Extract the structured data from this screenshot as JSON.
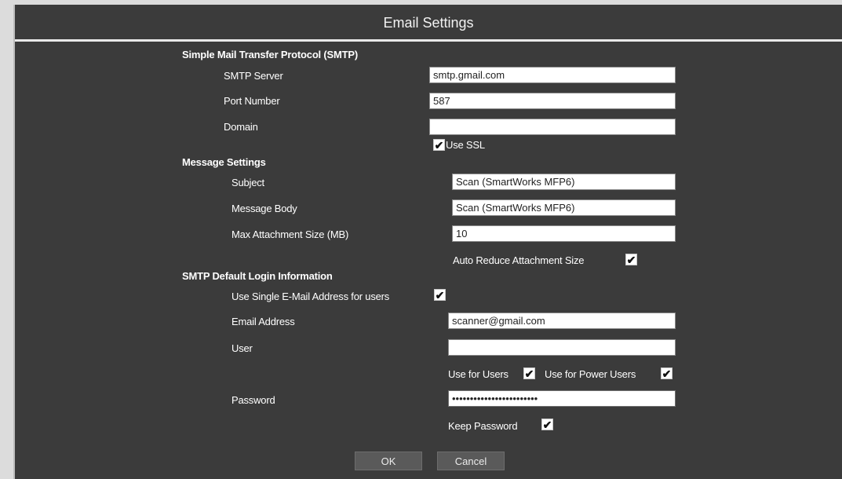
{
  "dialog": {
    "title": "Email Settings"
  },
  "smtp": {
    "heading": "Simple Mail Transfer Protocol (SMTP)",
    "server_label": "SMTP Server",
    "server_value": "smtp.gmail.com",
    "port_label": "Port Number",
    "port_value": "587",
    "domain_label": "Domain",
    "domain_value": "",
    "ssl_label": "Use SSL",
    "ssl_checked": true
  },
  "message": {
    "heading": "Message Settings",
    "subject_label": "Subject",
    "subject_value": "Scan (SmartWorks MFP6)",
    "body_label": "Message Body",
    "body_value": "Scan (SmartWorks MFP6)",
    "max_label": "Max Attachment Size (MB)",
    "max_value": "10",
    "auto_reduce_label": "Auto Reduce Attachment Size",
    "auto_reduce_checked": true
  },
  "login": {
    "heading": "SMTP Default Login Information",
    "single_email_label": "Use Single E-Mail Address for users",
    "single_email_checked": true,
    "email_label": "Email Address",
    "email_value": "scanner@gmail.com",
    "user_label": "User",
    "user_value": "",
    "use_for_users_label": "Use for Users",
    "use_for_users_checked": true,
    "use_for_power_users_label": "Use for Power Users",
    "use_for_power_users_checked": true,
    "password_label": "Password",
    "password_value": "••••••••••••••••••••••••",
    "keep_password_label": "Keep Password",
    "keep_password_checked": true
  },
  "buttons": {
    "ok": "OK",
    "cancel": "Cancel"
  },
  "icons": {
    "checkbox_checked": "check-icon"
  },
  "colors": {
    "background": "#3b3b3b",
    "text": "#ffffff",
    "field": "#ffffff"
  }
}
